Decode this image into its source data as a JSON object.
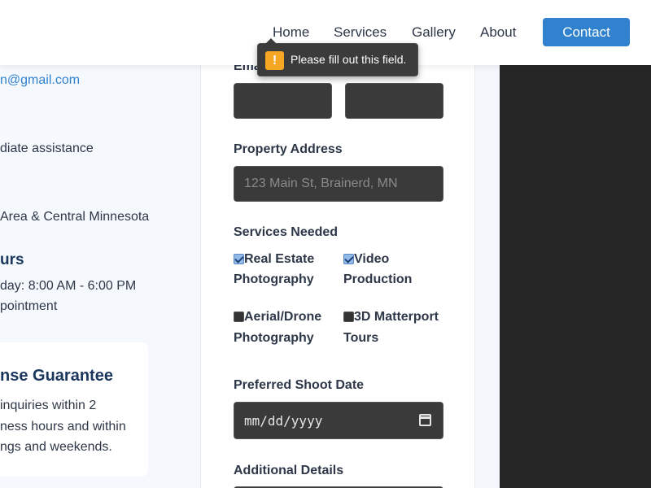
{
  "nav": {
    "items": [
      "Home",
      "Services",
      "Gallery",
      "About"
    ],
    "contact": "Contact"
  },
  "left": {
    "email": "n@gmail.com",
    "assistance": "diate assistance",
    "area": "Area & Central Minnesota",
    "hours_heading": "urs",
    "hours_line": "day: 8:00 AM - 6:00 PM",
    "appointment": "pointment",
    "guarantee": {
      "title": "nse Guarantee",
      "lines": [
        "inquiries within 2",
        "ness hours and within",
        "ngs and weekends."
      ]
    }
  },
  "form": {
    "email_label_fragment": "Ema",
    "address_label": "Property Address",
    "address_placeholder": "123 Main St, Brainerd, MN",
    "services_label": "Services Needed",
    "services": [
      {
        "line1": "Real Estate",
        "line2": "Photography",
        "checked": true
      },
      {
        "line1": "Video",
        "line2": "Production",
        "checked": true
      },
      {
        "line1": "Aerial/Drone",
        "line2": "Photography",
        "checked": false
      },
      {
        "line1": "3D Matterport",
        "line2": "Tours",
        "checked": false
      }
    ],
    "date_label": "Preferred Shoot Date",
    "date_placeholder": "mm/dd/yyyy",
    "details_label": "Additional Details"
  },
  "tooltip": {
    "text": "Please fill out this field."
  },
  "colors": {
    "accent": "#3182ce",
    "heading": "#1a365d",
    "dark_area": "#262626",
    "warning": "#f5a623"
  }
}
